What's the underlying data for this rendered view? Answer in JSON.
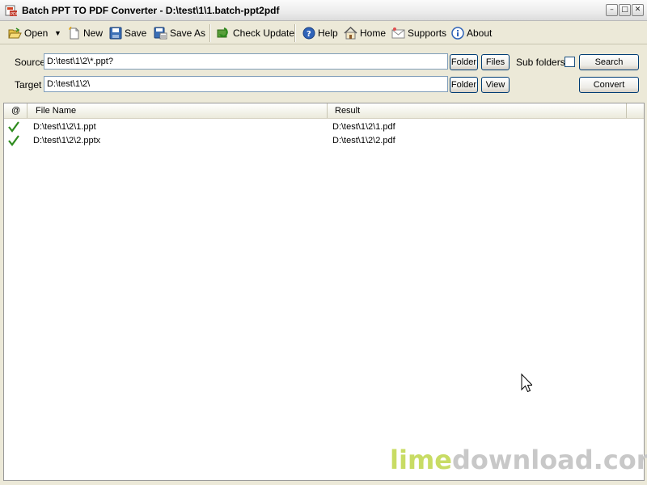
{
  "window": {
    "title": "Batch PPT TO PDF Converter - D:\\test\\1\\1.batch-ppt2pdf",
    "min_glyph": "–",
    "max_glyph": "□",
    "close_glyph": "✕"
  },
  "toolbar": {
    "open": "Open",
    "new": "New",
    "save": "Save",
    "save_as": "Save As",
    "check_update": "Check Update",
    "help": "Help",
    "home": "Home",
    "supports": "Supports",
    "about": "About"
  },
  "source": {
    "label": "Source",
    "value": "D:\\test\\1\\2\\*.ppt?",
    "folder_button": "Folder",
    "files_button": "Files",
    "subfolders_label": "Sub folders",
    "subfolders_checked": false,
    "search_button": "Search"
  },
  "target": {
    "label": "Target",
    "value": "D:\\test\\1\\2\\",
    "folder_button": "Folder",
    "view_button": "View",
    "convert_button": "Convert"
  },
  "list": {
    "columns": [
      "@",
      "File Name",
      "Result"
    ],
    "rows": [
      {
        "status": "done",
        "file": "D:\\test\\1\\2\\1.ppt",
        "result": "D:\\test\\1\\2\\1.pdf"
      },
      {
        "status": "done",
        "file": "D:\\test\\1\\2\\2.pptx",
        "result": "D:\\test\\1\\2\\2.pdf"
      }
    ]
  },
  "watermark": {
    "part1": "lime",
    "part2": "download",
    "part3": ".com",
    "color1": "#c8dc64",
    "color2": "#c8c8c8"
  },
  "colors": {
    "check_green": "#2e8b1e",
    "window_bg": "#ece9d8"
  }
}
